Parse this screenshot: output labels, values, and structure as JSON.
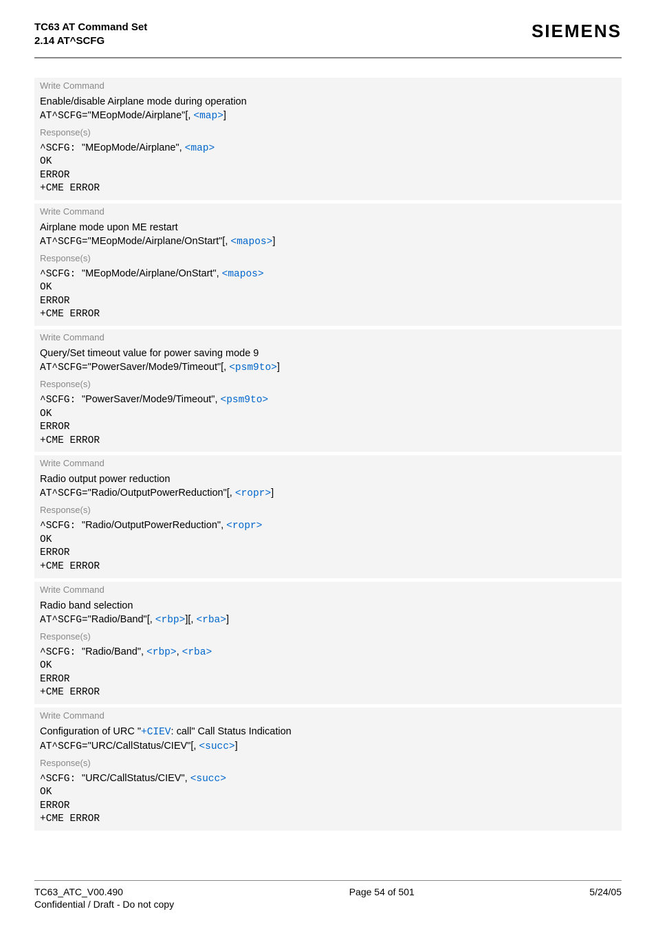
{
  "header": {
    "title_line1": "TC63 AT Command Set",
    "title_line2": "2.14 AT^SCFG",
    "brand": "SIEMENS"
  },
  "labels": {
    "write_command": "Write Command",
    "responses": "Response(s)",
    "ok": "OK",
    "error": "ERROR",
    "cme_error": "+CME ERROR"
  },
  "commands": [
    {
      "desc_plain": "Enable/disable Airplane mode during operation",
      "cmd_prefix": "AT^SCFG=",
      "cmd_arg": "\"MEopMode/Airplane\"",
      "cmd_suffix_before_param": "[, ",
      "param": "<map>",
      "cmd_suffix_after_param": "]",
      "resp_prefix": "^SCFG: ",
      "resp_arg": "\"MEopMode/Airplane\"",
      "resp_sep": ", ",
      "resp_param": "<map>"
    },
    {
      "desc_plain": "Airplane mode upon ME restart",
      "cmd_prefix": "AT^SCFG=",
      "cmd_arg": "\"MEopMode/Airplane/OnStart\"",
      "cmd_suffix_before_param": "[, ",
      "param": "<mapos>",
      "cmd_suffix_after_param": "]",
      "resp_prefix": "^SCFG: ",
      "resp_arg": "\"MEopMode/Airplane/OnStart\"",
      "resp_sep": ", ",
      "resp_param": "<mapos>"
    },
    {
      "desc_plain": "Query/Set timeout value for power saving mode 9",
      "cmd_prefix": "AT^SCFG=",
      "cmd_arg": "\"PowerSaver/Mode9/Timeout\"",
      "cmd_suffix_before_param": "[, ",
      "param": "<psm9to>",
      "cmd_suffix_after_param": "]",
      "resp_prefix": "^SCFG: ",
      "resp_arg": "\"PowerSaver/Mode9/Timeout\"",
      "resp_sep": ", ",
      "resp_param": "<psm9to>"
    },
    {
      "desc_plain": "Radio output power reduction",
      "cmd_prefix": "AT^SCFG=",
      "cmd_arg": "\"Radio/OutputPowerReduction\"",
      "cmd_suffix_before_param": "[, ",
      "param": "<ropr>",
      "cmd_suffix_after_param": "]",
      "resp_prefix": "^SCFG: ",
      "resp_arg": "\"Radio/OutputPowerReduction\"",
      "resp_sep": ", ",
      "resp_param": "<ropr>"
    }
  ],
  "radio_band": {
    "desc": "Radio band selection",
    "cmd_prefix": "AT^SCFG=",
    "cmd_arg": "\"Radio/Band\"",
    "br1_open": "[, ",
    "param1": "<rbp>",
    "br1_close": "]",
    "br2_open": "[, ",
    "param2": "<rba>",
    "br2_close": "]",
    "resp_prefix": "^SCFG: ",
    "resp_arg": "\"Radio/Band\"",
    "resp_sep1": ", ",
    "resp_param1": "<rbp>",
    "resp_sep2": ", ",
    "resp_param2": "<rba>"
  },
  "urc_block": {
    "desc_pre": "Configuration of URC \"",
    "desc_link": "+CIEV",
    "desc_post": ": call\" Call Status Indication",
    "cmd_prefix": "AT^SCFG=",
    "cmd_arg": "\"URC/CallStatus/CIEV\"",
    "cmd_suffix_before_param": "[, ",
    "param": "<succ>",
    "cmd_suffix_after_param": "]",
    "resp_prefix": "^SCFG: ",
    "resp_arg": "\"URC/CallStatus/CIEV\"",
    "resp_sep": ", ",
    "resp_param": "<succ>"
  },
  "footer": {
    "left": "TC63_ATC_V00.490",
    "center": "Page 54 of 501",
    "right": "5/24/05",
    "confidential": "Confidential / Draft - Do not copy"
  }
}
